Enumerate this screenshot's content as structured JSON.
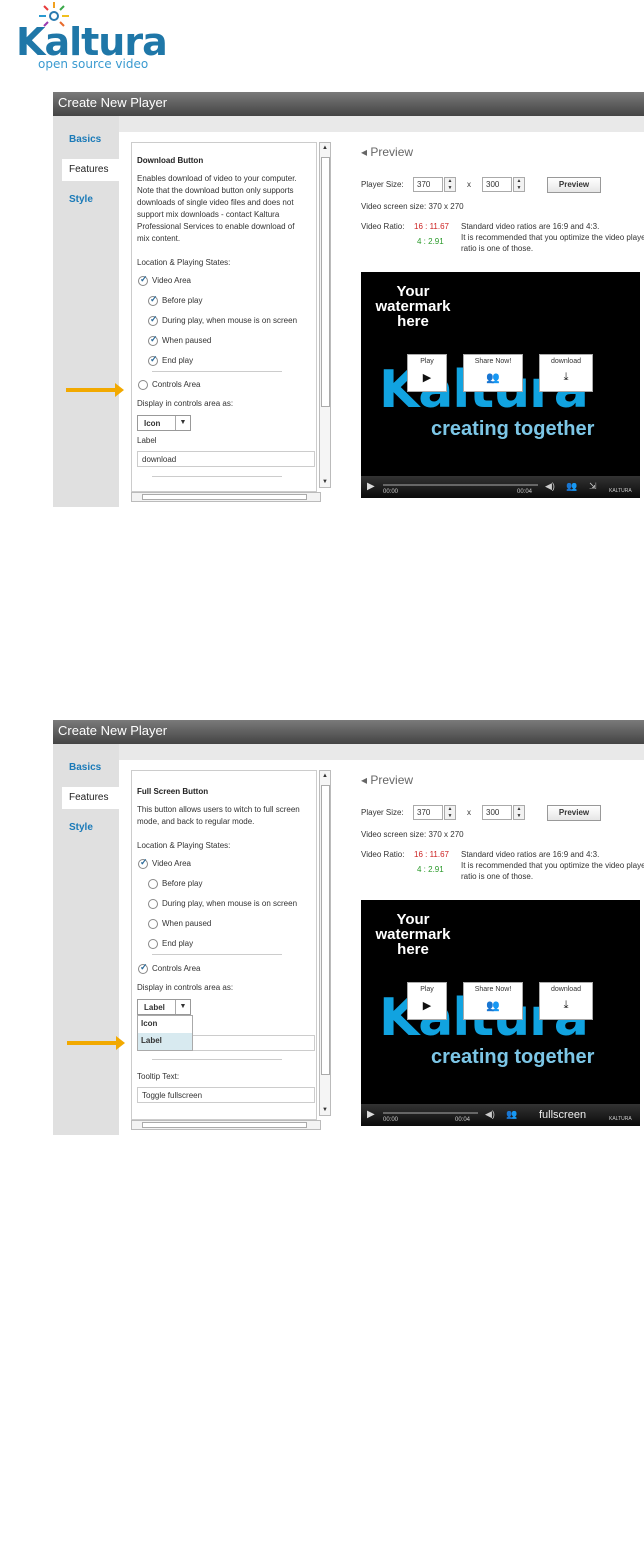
{
  "logo": {
    "word": "Kaltura",
    "tagline": "open source video"
  },
  "panels": [
    {
      "title": "Create New Player",
      "nav": [
        "Basics",
        "Features",
        "Style"
      ],
      "section_title": "Download Button",
      "description": [
        "Enables download of video to your computer.",
        "Note that the download button only supports",
        "downloads of single video files and does not",
        "support mix downloads - contact Kaltura",
        "Professional Services to enable download of",
        "mix content."
      ],
      "states_label": "Location & Playing States:",
      "video_area": "Video Area",
      "before_play": "Before play",
      "during_play": "During play, when mouse is on screen",
      "when_paused": "When paused",
      "end_play": "End play",
      "controls_area": "Controls Area",
      "display_label": "Display in controls area as:",
      "select_value": "Icon",
      "label_label": "Label",
      "label_value": "download"
    },
    {
      "title": "Create New Player",
      "nav": [
        "Basics",
        "Features",
        "Style"
      ],
      "section_title": "Full Screen Button",
      "description": [
        "This button allows users to witch to full screen",
        "mode, and back to regular mode."
      ],
      "states_label": "Location & Playing States:",
      "video_area": "Video Area",
      "before_play": "Before play",
      "during_play": "During play, when mouse is on screen",
      "when_paused": "When paused",
      "end_play": "End play",
      "controls_area": "Controls Area",
      "display_label": "Display in controls area as:",
      "select_value": "Label",
      "dropdown_options": [
        "Icon",
        "Label"
      ],
      "tooltip_label": "Tooltip Text:",
      "tooltip_value": "Toggle fullscreen"
    }
  ],
  "preview": {
    "header": "Preview",
    "player_size_label": "Player Size:",
    "width": "370",
    "times": "x",
    "height": "300",
    "preview_button": "Preview",
    "screen_size": "Video screen size: 370 x 270",
    "ratio_label": "Video Ratio:",
    "ratio_1": "16 : 11.67",
    "ratio_2": "4 : 2.91",
    "ratio_note_1": "Standard video ratios are 16:9 and 4:3.",
    "ratio_note_2": "It is recommended that you optimize the video player's",
    "ratio_note_3": "ratio is one of those."
  },
  "video": {
    "watermark": [
      "Your",
      "watermark",
      "here"
    ],
    "brand": "Kaltura",
    "slogan": "creating together",
    "buttons": [
      "Play",
      "Share Now!",
      "download"
    ],
    "time_start": "00:00",
    "time_end": "00:04",
    "fullscreen_label": "fullscreen",
    "vendor": "KALTURA"
  },
  "colors": {
    "ratio_red": "#cc2222",
    "ratio_green": "#2a9a2a",
    "arrow": "#f2a900"
  }
}
